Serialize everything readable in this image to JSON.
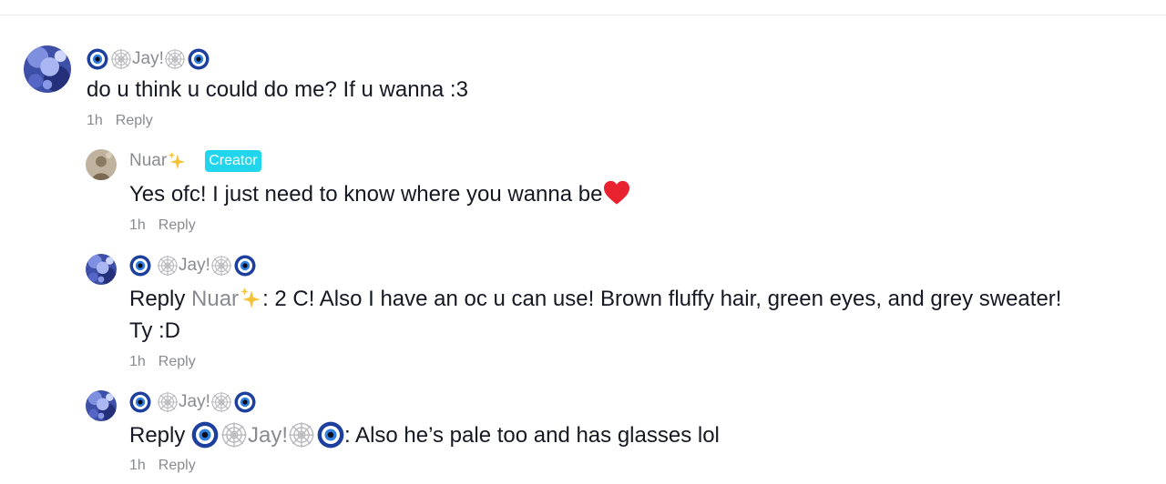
{
  "comments": [
    {
      "username": "Jay!",
      "text": "do u think u could do me? If u wanna :3",
      "time": "1h",
      "reply_label": "Reply"
    },
    {
      "username": "Nuar",
      "badge": "Creator",
      "text": "Yes ofc! I just need to know where you wanna be",
      "time": "1h",
      "reply_label": "Reply"
    },
    {
      "username": "Jay!",
      "reply_prefix": "Reply",
      "mention": "Nuar",
      "text_line1": ": 2 C! Also I have an oc u can use! Brown fluffy hair, green eyes, and grey sweater!",
      "text_line2": "Ty :D",
      "time": "1h",
      "reply_label": "Reply"
    },
    {
      "username": "Jay!",
      "reply_prefix": "Reply",
      "mention": "Jay!",
      "text": ": Also he’s pale too and has glasses lol",
      "time": "1h",
      "reply_label": "Reply"
    }
  ],
  "colors": {
    "secondary_text": "#8a8b91",
    "primary_text": "#161823",
    "creator_badge": "#20d5ec"
  },
  "icons": [
    "nazar-eye-icon",
    "spider-web-icon",
    "sparkles-icon",
    "red-heart-icon"
  ]
}
